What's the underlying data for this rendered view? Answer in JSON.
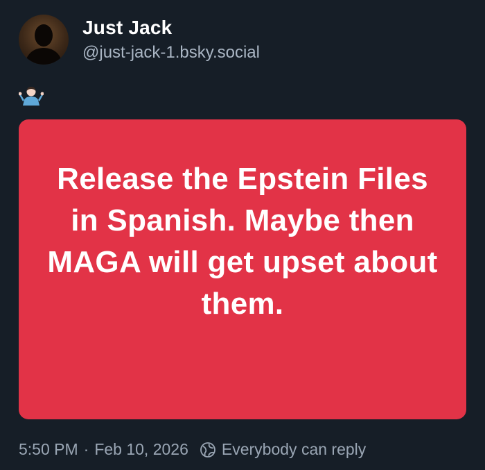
{
  "author": {
    "display_name": "Just Jack",
    "handle": "@just-jack-1.bsky.social",
    "avatar_icon": "avatar-silhouette"
  },
  "post": {
    "emoji": "🤷🏻‍♂️",
    "image_text": "Release the Epstein Files in Spanish. Maybe then MAGA will get upset about them.",
    "image_background": "#e23347"
  },
  "meta": {
    "time": "5:50 PM",
    "separator": "·",
    "date": "Feb 10, 2026",
    "reply_setting_icon": "globe-icon",
    "reply_setting": "Everybody can reply"
  },
  "colors": {
    "background": "#161e27",
    "name": "#ffffff",
    "handle": "#aab6c4",
    "meta": "#9aa6b4"
  }
}
